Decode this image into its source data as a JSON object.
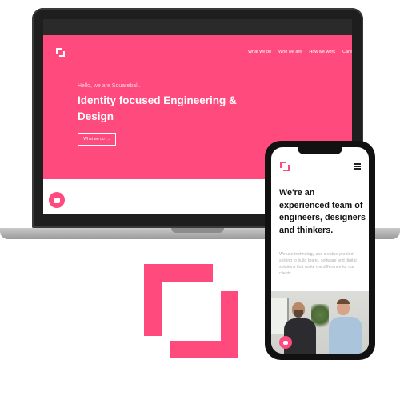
{
  "laptop": {
    "nav": [
      "What we do",
      "Who we are",
      "How we work",
      "Care"
    ],
    "hello": "Hello, we are Squareball.",
    "heading": "Identity focused Engineering & Design",
    "cta_label": "What we do",
    "cta_arrow": "→"
  },
  "phone": {
    "heading": "We're an experienced team of engineers, designers and thinkers.",
    "body": "We use technology and creative problem-solving to build brand, software and digital solutions that make the difference for our clients."
  },
  "colors": {
    "brand": "#ff4a7d",
    "laptop_frame": "#1e1e1e",
    "phone_frame": "#111111"
  },
  "icons": [
    "squareball-logo-icon",
    "hamburger-menu-icon",
    "chat-bubble-icon",
    "arrow-right-icon"
  ]
}
